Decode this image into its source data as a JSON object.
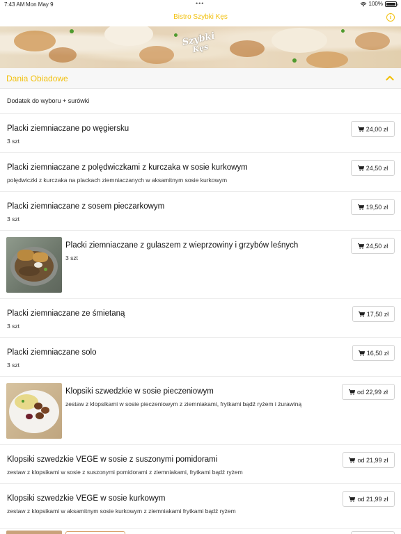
{
  "status_bar": {
    "time": "7:43 AM",
    "date": "Mon May 9",
    "dots": "•••",
    "battery": "100%"
  },
  "nav": {
    "title": "Bistro Szybki Kęs"
  },
  "banner": {
    "logo_line1": "Szybki",
    "logo_line2": "Kęs"
  },
  "section": {
    "title": "Dania Obiadowe",
    "subheading": "Dodatek do wyboru + surówki"
  },
  "items": [
    {
      "name": "Placki ziemniaczane po węgiersku",
      "desc": "3 szt",
      "price": "24,00 zł"
    },
    {
      "name": "Placki ziemniaczane z polędwiczkami z kurczaka w sosie kurkowym",
      "desc": "polędwiczki z kurczaka na plackach ziemniaczanych w aksamitnym sosie kurkowym",
      "price": "24,50 zł"
    },
    {
      "name": "Placki ziemniaczane z sosem pieczarkowym",
      "desc": "3 szt",
      "price": "19,50 zł"
    },
    {
      "name": "Placki ziemniaczane z gulaszem z wieprzowiny i grzybów leśnych",
      "desc": "3 szt",
      "price": "24,50 zł"
    },
    {
      "name": "Placki ziemniaczane ze śmietaną",
      "desc": "3 szt",
      "price": "17,50 zł"
    },
    {
      "name": "Placki ziemniaczane solo",
      "desc": "3 szt",
      "price": "16,50 zł"
    },
    {
      "name": "Klopsiki szwedzkie w sosie pieczeniowym",
      "desc": "zestaw z klopsikami w sosie pieczeniowym z ziemniakami, frytkami bądź ryżem i żurawiną",
      "price": "od 22,99 zł"
    },
    {
      "name": "Klopsiki szwedzkie VEGE w sosie z suszonymi pomidorami",
      "desc": "zestaw z klopsikami w sosie z suszonymi pomidorami z ziemniakami, frytkami bądź ryżem",
      "price": "od 21,99 zł"
    },
    {
      "name": "Klopsiki szwedzkie VEGE w sosie kurkowym",
      "desc": "zestaw z klopsikami w aksamitnym sosie kurkowym z ziemniakami frytkami bądź ryżem",
      "price": "od 21,99 zł"
    }
  ],
  "colors": {
    "accent": "#f2c10f",
    "divider": "#ececec"
  }
}
